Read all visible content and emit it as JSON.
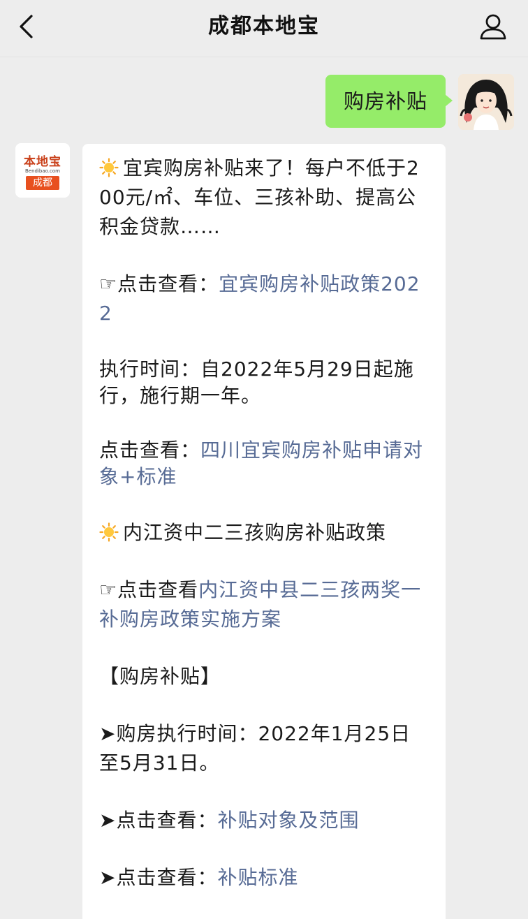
{
  "header": {
    "title": "成都本地宝"
  },
  "outgoing": {
    "text": "购房补贴"
  },
  "bot": {
    "logo_brand": "本地宝",
    "logo_domain": "Bendibao.com",
    "logo_city": "成都"
  },
  "reply": {
    "p1": "宜宾购房补贴来了！每户不低于200元/㎡、车位、三孩补助、提高公积金贷款……",
    "p2_prefix": "☞点击查看：",
    "p2_link": "宜宾购房补贴政策2022",
    "p3": "执行时间：自2022年5月29日起施行，施行期一年。",
    "p4_prefix": "点击查看：",
    "p4_link": "四川宜宾购房补贴申请对象+标准",
    "p5": "内江资中二三孩购房补贴政策",
    "p6_prefix": "☞点击查看",
    "p6_link": "内江资中县二三孩两奖一补购房政策实施方案",
    "p7": "【购房补贴】",
    "p8": "➤购房执行时间：2022年1月25日至5月31日。",
    "p9_prefix": "➤点击查看：",
    "p9_link": "补贴对象及范围",
    "p10_prefix": "➤点击查看：",
    "p10_link": "补贴标准"
  },
  "colors": {
    "background": "#ededed",
    "outgoing_bubble": "#95ec69",
    "incoming_bubble": "#ffffff",
    "link": "#576b95"
  }
}
